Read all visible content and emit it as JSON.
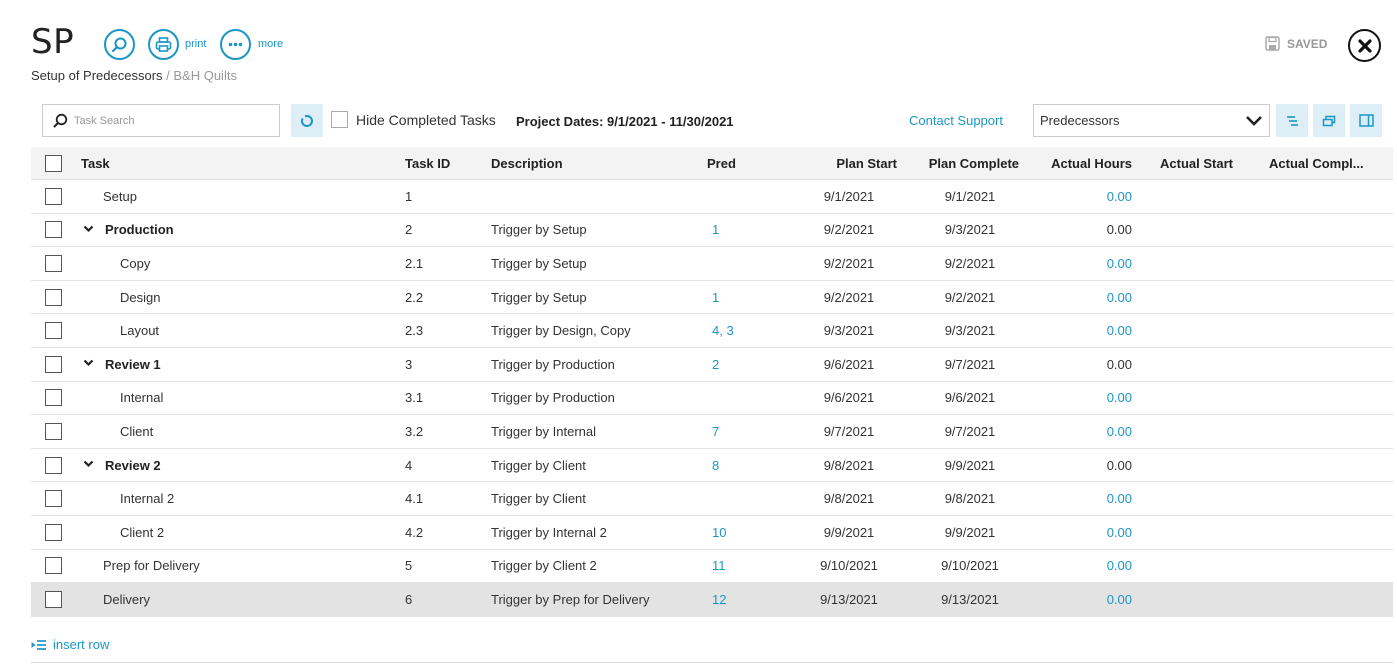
{
  "header": {
    "app_title": "SP",
    "print_label": "print",
    "more_label": "more",
    "breadcrumb_page": "Setup of Predecessors",
    "breadcrumb_sep": " / ",
    "breadcrumb_client": "B&H Quilts",
    "saved_label": "SAVED"
  },
  "toolbar": {
    "search_placeholder": "Task Search",
    "hide_completed_label": "Hide Completed Tasks",
    "project_dates": "Project Dates: 9/1/2021 - 11/30/2021",
    "contact_support": "Contact Support",
    "view_selected": "Predecessors"
  },
  "table": {
    "headers": {
      "task": "Task",
      "task_id": "Task ID",
      "description": "Description",
      "pred": "Pred",
      "plan_start": "Plan Start",
      "plan_complete": "Plan Complete",
      "actual_hours": "Actual Hours",
      "actual_start": "Actual Start",
      "actual_complete": "Actual Compl..."
    },
    "rows": [
      {
        "task": "Setup",
        "level": 0,
        "group": false,
        "id": "1",
        "desc": "",
        "pred": "",
        "plan_start": "9/1/2021",
        "plan_complete": "9/1/2021",
        "hours": "0.00",
        "hours_link": true
      },
      {
        "task": "Production",
        "level": 0,
        "group": true,
        "id": "2",
        "desc": "Trigger by Setup",
        "pred": "1",
        "plan_start": "9/2/2021",
        "plan_complete": "9/3/2021",
        "hours": "0.00",
        "hours_link": false
      },
      {
        "task": "Copy",
        "level": 1,
        "group": false,
        "id": "2.1",
        "desc": "Trigger by Setup",
        "pred": "",
        "plan_start": "9/2/2021",
        "plan_complete": "9/2/2021",
        "hours": "0.00",
        "hours_link": true
      },
      {
        "task": "Design",
        "level": 1,
        "group": false,
        "id": "2.2",
        "desc": "Trigger by Setup",
        "pred": "1",
        "plan_start": "9/2/2021",
        "plan_complete": "9/2/2021",
        "hours": "0.00",
        "hours_link": true
      },
      {
        "task": "Layout",
        "level": 1,
        "group": false,
        "id": "2.3",
        "desc": "Trigger by Design, Copy",
        "pred": "4, 3",
        "plan_start": "9/3/2021",
        "plan_complete": "9/3/2021",
        "hours": "0.00",
        "hours_link": true
      },
      {
        "task": "Review 1",
        "level": 0,
        "group": true,
        "id": "3",
        "desc": "Trigger by Production",
        "pred": "2",
        "plan_start": "9/6/2021",
        "plan_complete": "9/7/2021",
        "hours": "0.00",
        "hours_link": false
      },
      {
        "task": "Internal",
        "level": 1,
        "group": false,
        "id": "3.1",
        "desc": "Trigger by Production",
        "pred": "",
        "plan_start": "9/6/2021",
        "plan_complete": "9/6/2021",
        "hours": "0.00",
        "hours_link": true
      },
      {
        "task": "Client",
        "level": 1,
        "group": false,
        "id": "3.2",
        "desc": "Trigger by Internal",
        "pred": "7",
        "plan_start": "9/7/2021",
        "plan_complete": "9/7/2021",
        "hours": "0.00",
        "hours_link": true
      },
      {
        "task": "Review 2",
        "level": 0,
        "group": true,
        "id": "4",
        "desc": "Trigger by Client",
        "pred": "8",
        "plan_start": "9/8/2021",
        "plan_complete": "9/9/2021",
        "hours": "0.00",
        "hours_link": false
      },
      {
        "task": "Internal 2",
        "level": 1,
        "group": false,
        "id": "4.1",
        "desc": "Trigger by Client",
        "pred": "",
        "plan_start": "9/8/2021",
        "plan_complete": "9/8/2021",
        "hours": "0.00",
        "hours_link": true
      },
      {
        "task": "Client 2",
        "level": 1,
        "group": false,
        "id": "4.2",
        "desc": "Trigger by Internal 2",
        "pred": "10",
        "plan_start": "9/9/2021",
        "plan_complete": "9/9/2021",
        "hours": "0.00",
        "hours_link": true
      },
      {
        "task": "Prep for Delivery",
        "level": 0,
        "group": false,
        "id": "5",
        "desc": "Trigger by Client 2",
        "pred": "11",
        "plan_start": "9/10/2021",
        "plan_complete": "9/10/2021",
        "hours": "0.00",
        "hours_link": true
      },
      {
        "task": "Delivery",
        "level": 0,
        "group": false,
        "id": "6",
        "desc": "Trigger by Prep for Delivery",
        "pred": "12",
        "plan_start": "9/13/2021",
        "plan_complete": "9/13/2021",
        "hours": "0.00",
        "hours_link": true,
        "selected": true
      }
    ]
  },
  "footer": {
    "insert_row_label": "insert row"
  },
  "colors": {
    "accent": "#1b97c6",
    "toolbar_button_bg": "#ddeef6",
    "header_bg": "#f3f3f3",
    "selected_row_bg": "#e3e3e3"
  }
}
